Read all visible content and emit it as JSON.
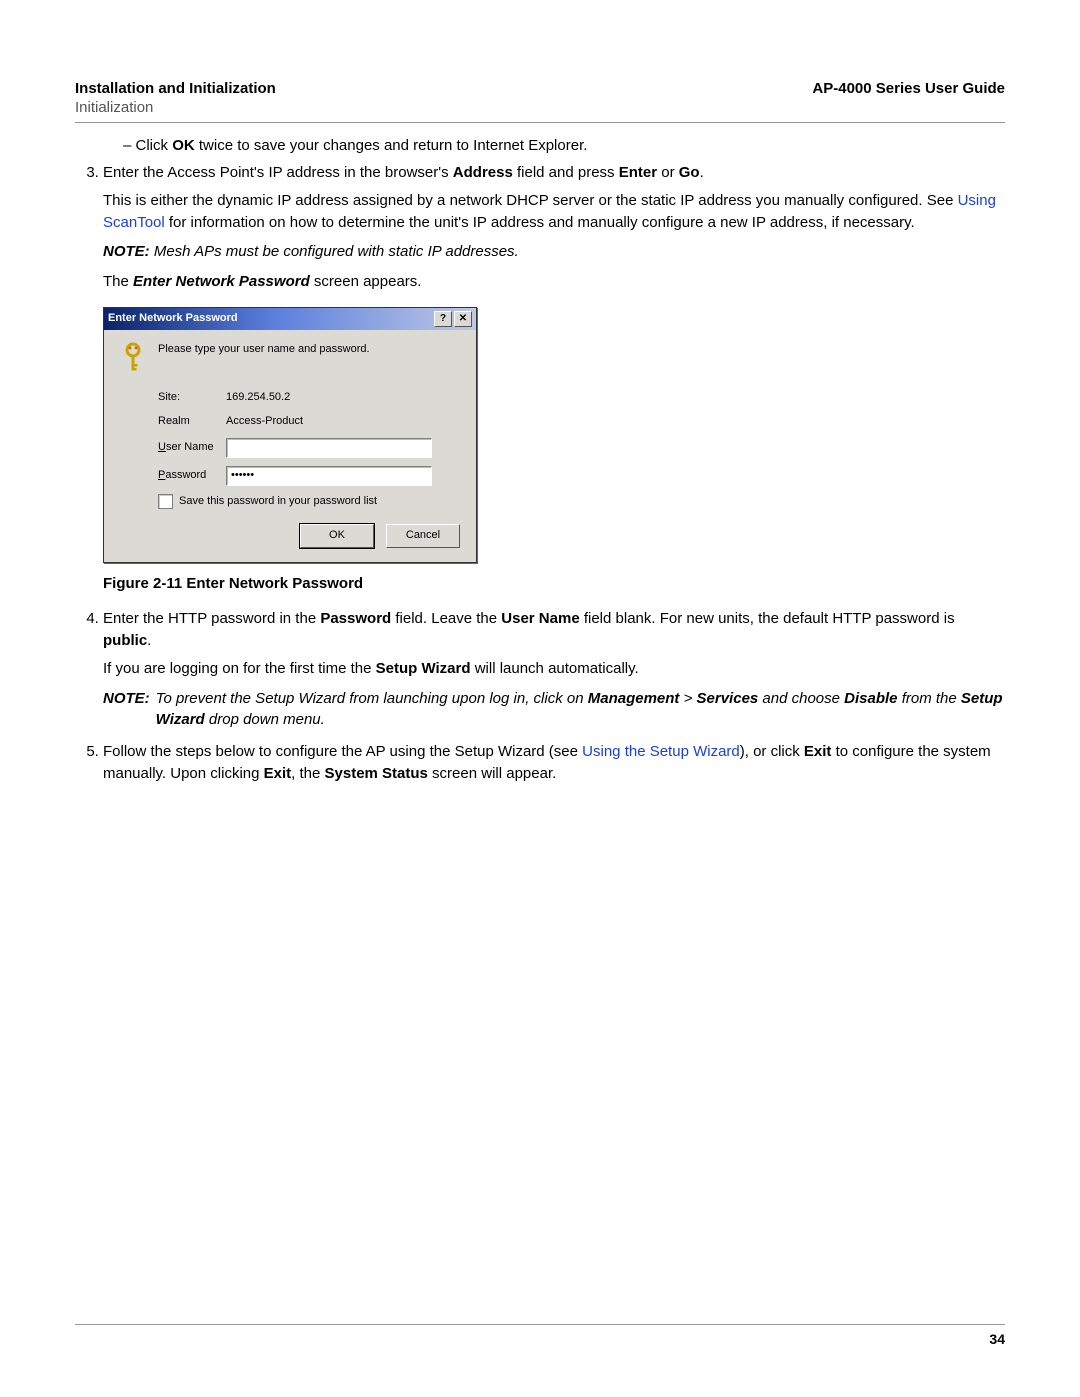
{
  "header": {
    "section_title": "Installation and Initialization",
    "subsection": "Initialization",
    "doc_title": "AP-4000 Series User Guide"
  },
  "body": {
    "bullet_click": {
      "pre": "Click ",
      "b1": "OK",
      "post": " twice to save your changes and return to Internet Explorer."
    },
    "step3": {
      "lead": {
        "pre": "Enter the Access Point's IP address in the browser's ",
        "b1": "Address",
        "mid": " field and press ",
        "b2": "Enter",
        "or": " or ",
        "b3": "Go",
        "end": "."
      },
      "desc": {
        "p1": "This is either the dynamic IP address assigned by a network DHCP server or the static IP address you manually configured. See ",
        "link": "Using ScanTool",
        "p2": " for information on how to determine the unit's IP address and manually configure a new IP address, if necessary."
      },
      "note": "Mesh APs must be configured with static IP addresses.",
      "after_note": {
        "pre": "The ",
        "bi": "Enter Network Password",
        "post": " screen appears."
      }
    },
    "figure_caption": "Figure 2-11 Enter Network Password",
    "step4": {
      "lead": {
        "p1": "Enter the HTTP password in the ",
        "b1": "Password",
        "p2": " field. Leave the ",
        "b2": "User Name",
        "p3": " field blank. For new units, the default HTTP password is ",
        "b3": "public",
        "p4": "."
      },
      "wizard": {
        "p1": "If you are logging on for the first time the ",
        "b1": "Setup Wizard",
        "p2": " will launch automatically."
      },
      "note": {
        "p1": "To prevent the Setup Wizard from launching upon log in, click on ",
        "b1": "Management",
        "sep": " > ",
        "b2": "Services",
        "p2": " and choose ",
        "b3": "Disable",
        "p3": " from the ",
        "b4": "Setup Wizard",
        "p4": " drop down menu."
      }
    },
    "step5": {
      "p1": "Follow the steps below to configure the AP using the Setup Wizard (see ",
      "link": "Using the Setup Wizard",
      "p2": "), or click ",
      "b1": "Exit",
      "p3": " to configure the system manually. Upon clicking ",
      "b2": "Exit",
      "p4": ", the ",
      "b3": "System Status",
      "p5": " screen will appear."
    },
    "note_label": "NOTE:"
  },
  "dialog": {
    "title": "Enter Network Password",
    "help_glyph": "?",
    "close_glyph": "✕",
    "instruction": "Please type your user name and password.",
    "site_label": "Site:",
    "site_value": "169.254.50.2",
    "realm_label": "Realm",
    "realm_value": "Access-Product",
    "user_label_pre": "U",
    "user_label_rest": "ser Name",
    "pass_label_pre": "P",
    "pass_label_rest": "assword",
    "password_value": "••••••",
    "save_pre": "S",
    "save_rest": "ave this password in your password list",
    "ok": "OK",
    "cancel": "Cancel"
  },
  "footer": {
    "page_number": "34"
  }
}
